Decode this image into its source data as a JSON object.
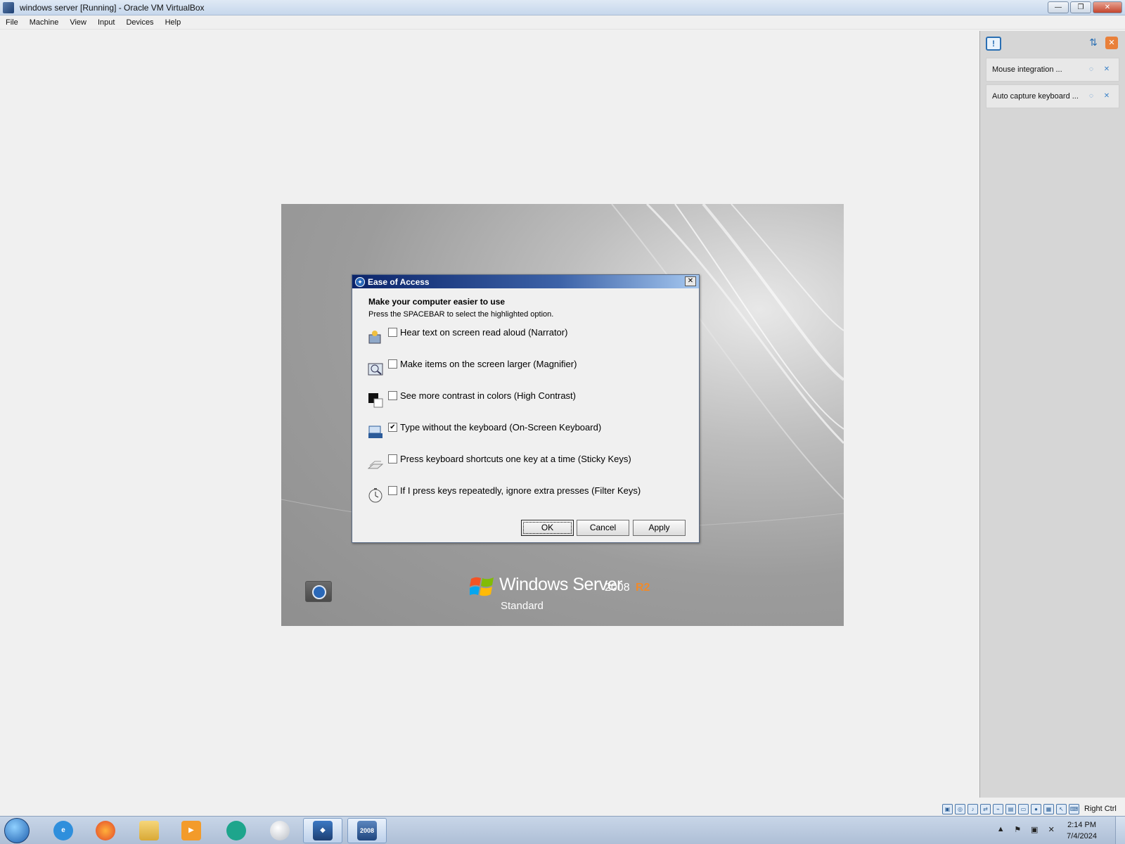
{
  "window": {
    "title": "windows server [Running] - Oracle VM VirtualBox",
    "controls": [
      "—",
      "❐",
      "✕"
    ]
  },
  "menu": [
    "File",
    "Machine",
    "View",
    "Input",
    "Devices",
    "Help"
  ],
  "side_panel": {
    "items": [
      {
        "label": "Mouse integration ..."
      },
      {
        "label": "Auto capture keyboard ..."
      }
    ]
  },
  "dialog": {
    "title": "Ease of Access",
    "heading": "Make your computer easier to use",
    "subtitle": "Press the SPACEBAR to select the highlighted option.",
    "options": [
      {
        "label": "Hear text on screen read aloud (Narrator)",
        "checked": false,
        "icon": "narrator-icon"
      },
      {
        "label": "Make items on the screen larger (Magnifier)",
        "checked": false,
        "icon": "magnifier-icon"
      },
      {
        "label": "See more contrast in colors (High Contrast)",
        "checked": false,
        "icon": "high-contrast-icon"
      },
      {
        "label": "Type without the keyboard (On-Screen Keyboard)",
        "checked": true,
        "icon": "keyboard-icon"
      },
      {
        "label": "Press keyboard shortcuts one key at a time (Sticky Keys)",
        "checked": false,
        "icon": "sticky-keys-icon"
      },
      {
        "label": "If I press keys repeatedly, ignore extra presses (Filter Keys)",
        "checked": false,
        "icon": "filter-keys-icon"
      }
    ],
    "buttons": {
      "ok": "OK",
      "cancel": "Cancel",
      "apply": "Apply"
    }
  },
  "branding": {
    "name": "Windows Server",
    "version": "2008",
    "release": "R2",
    "edition": "Standard"
  },
  "statusbar": {
    "host_key": "Right Ctrl"
  },
  "taskbar": {
    "apps": [
      "internet-explorer",
      "firefox",
      "file-explorer",
      "media-player",
      "app-teal",
      "app-sphere",
      "virtualbox",
      "windows-server-2008"
    ],
    "vm_badge": "2008",
    "clock": {
      "time": "2:14 PM",
      "date": "7/4/2024"
    }
  }
}
